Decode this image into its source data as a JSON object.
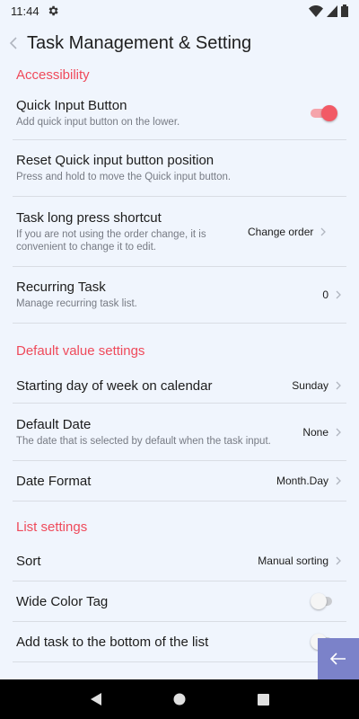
{
  "status": {
    "time": "11:44"
  },
  "header": {
    "title": "Task Management & Setting"
  },
  "sections": {
    "accessibility": "Accessibility",
    "defaults": "Default value settings",
    "list": "List settings"
  },
  "rows": {
    "quick_input": {
      "label": "Quick Input Button",
      "sub": "Add quick input button on the lower.",
      "enabled": true
    },
    "reset_position": {
      "label": "Reset Quick input button position",
      "sub": "Press and hold to move the Quick input button."
    },
    "long_press": {
      "label": "Task long press shortcut",
      "sub": "If you are not using the order change, it is convenient to change it to edit.",
      "value": "Change order"
    },
    "recurring": {
      "label": "Recurring Task",
      "sub": "Manage recurring task list.",
      "value": "0"
    },
    "start_day": {
      "label": "Starting day of week on calendar",
      "value": "Sunday"
    },
    "default_date": {
      "label": "Default Date",
      "sub": "The date that is selected by default when the task input.",
      "value": "None"
    },
    "date_format": {
      "label": "Date Format",
      "value": "Month.Day"
    },
    "sort": {
      "label": "Sort",
      "value": "Manual sorting"
    },
    "wide_color": {
      "label": "Wide Color Tag",
      "enabled": false
    },
    "add_bottom": {
      "label": "Add task to the bottom of the list",
      "enabled": false
    }
  },
  "colors": {
    "accent": "#ef4a5b",
    "background": "#f0f5fd",
    "fab": "#7b82c9"
  },
  "icons": {
    "settings": "gear-icon",
    "wifi": "wifi-icon",
    "signal": "signal-icon",
    "battery": "battery-icon",
    "back": "chevron-left-icon",
    "chevron": "chevron-right-icon",
    "fab": "arrow-left-icon",
    "nav_back": "triangle-back-icon",
    "nav_home": "circle-home-icon",
    "nav_recents": "square-recents-icon"
  }
}
